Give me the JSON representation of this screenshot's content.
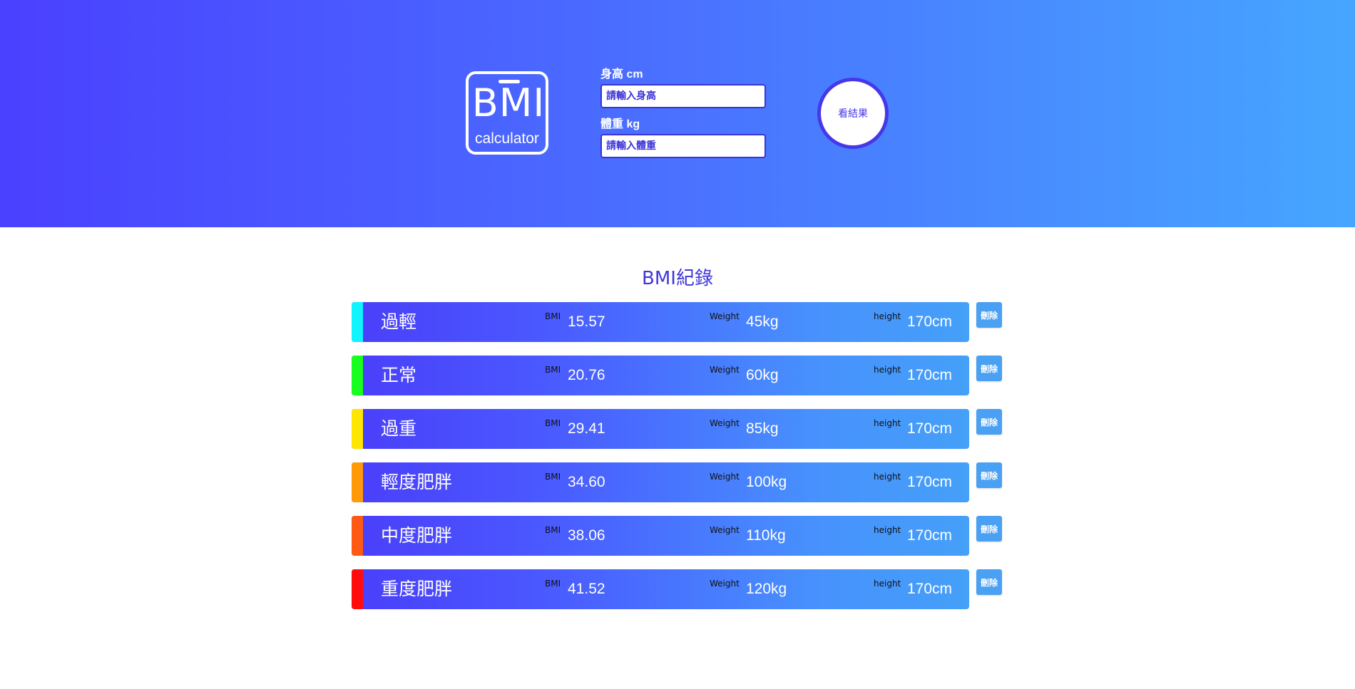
{
  "header": {
    "logo": {
      "main": "BMI",
      "sub": "calculator"
    },
    "height_field": {
      "label": "身高 cm",
      "placeholder": "請輸入身高"
    },
    "weight_field": {
      "label": "體重 kg",
      "placeholder": "請輸入體重"
    },
    "result_button": "看結果"
  },
  "records": {
    "title": "BMI紀錄",
    "bmi_label": "BMI",
    "weight_label": "Weight",
    "height_label": "height",
    "delete_label": "刪除",
    "items": [
      {
        "status": "過輕",
        "status_color": "#0ff4ff",
        "bmi": "15.57",
        "weight": "45kg",
        "height": "170cm"
      },
      {
        "status": "正常",
        "status_color": "#18ff1f",
        "bmi": "20.76",
        "weight": "60kg",
        "height": "170cm"
      },
      {
        "status": "過重",
        "status_color": "#ffe600",
        "bmi": "29.41",
        "weight": "85kg",
        "height": "170cm"
      },
      {
        "status": "輕度肥胖",
        "status_color": "#ff9908",
        "bmi": "34.60",
        "weight": "100kg",
        "height": "170cm"
      },
      {
        "status": "中度肥胖",
        "status_color": "#ff5a14",
        "bmi": "38.06",
        "weight": "110kg",
        "height": "170cm"
      },
      {
        "status": "重度肥胖",
        "status_color": "#ff0d0d",
        "bmi": "41.52",
        "weight": "120kg",
        "height": "170cm"
      }
    ]
  }
}
